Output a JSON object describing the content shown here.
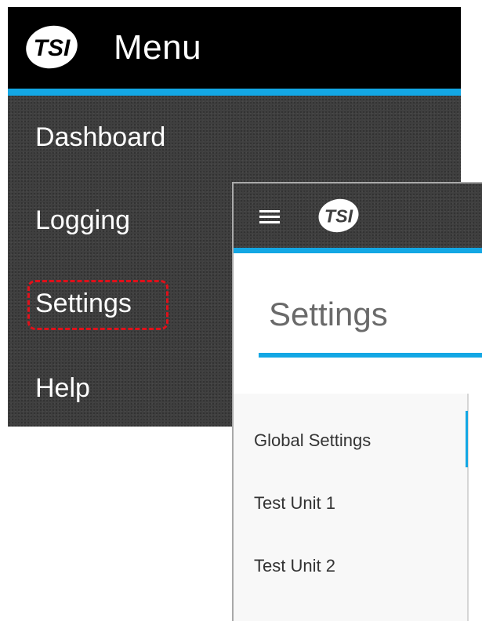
{
  "menu": {
    "title": "Menu",
    "logo_text": "TSI",
    "items": [
      {
        "label": "Dashboard"
      },
      {
        "label": "Logging"
      },
      {
        "label": "Settings"
      },
      {
        "label": "Help"
      }
    ],
    "highlighted_item": "Settings"
  },
  "settings_window": {
    "logo_text": "TSI",
    "hamburger_icon": "menu-icon",
    "title": "Settings",
    "nav": [
      {
        "label": "Global Settings"
      },
      {
        "label": "Test Unit 1"
      },
      {
        "label": "Test Unit 2"
      }
    ]
  },
  "colors": {
    "accent": "#13a7e4",
    "menu_bg": "#3f3f3f",
    "header_bg": "#000000",
    "highlight": "#e0101a"
  }
}
